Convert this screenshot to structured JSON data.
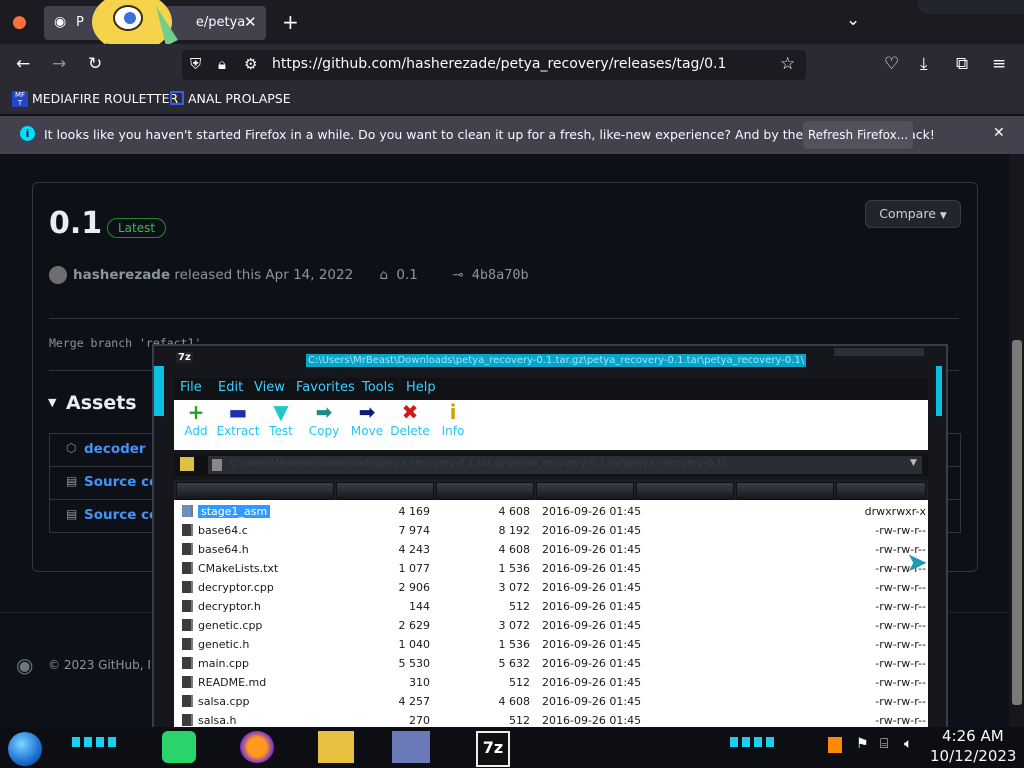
{
  "browser": {
    "tab_title": "P",
    "tab_title_tail": "e/petya",
    "url": "https://github.com/hasherezade/petya_recovery/releases/tag/0.1",
    "bookmarks": [
      "MEDIAFIRE ROULETTER",
      "ANAL PROLAPSE"
    ],
    "notice": "It looks like you haven't started Firefox in a while. Do you want to clean it up for a fresh, like-new experience? And by the way, welcome back!",
    "refresh_label": "Refresh Firefox...",
    "icons": [
      "firefox-icon",
      "github-icon",
      "close-icon",
      "new-tab-icon",
      "chevron-down-icon",
      "back-icon",
      "forward-icon",
      "reload-icon",
      "shield-icon",
      "lock-icon",
      "settings-icon",
      "star-icon",
      "pocket-icon",
      "download-icon",
      "extensions-icon",
      "menu-icon",
      "info-icon"
    ]
  },
  "release": {
    "title": "0.1",
    "badge": "Latest",
    "compare_label": "Compare",
    "author": "hasherezade",
    "released_text": "released this Apr 14, 2022",
    "tag": "0.1",
    "commit": "4b8a70b",
    "commit_message": "Merge branch 'refact1'",
    "assets_heading": "Assets",
    "assets": [
      "decoder",
      "Source code",
      "Source code"
    ],
    "footer": "© 2023 GitHub, Inc."
  },
  "sevenzip": {
    "title_path": "C:\\Users\\MrBeast\\Downloads\\petya_recovery-0.1.tar.gz\\petya_recovery-0.1.tar\\petya_recovery-0.1\\",
    "menus": [
      "File",
      "Edit",
      "View",
      "Favorites",
      "Tools",
      "Help"
    ],
    "tools": [
      {
        "label": "Add",
        "glyph": "+",
        "color": "#1fa31f"
      },
      {
        "label": "Extract",
        "glyph": "—",
        "color": "#1c2fb0"
      },
      {
        "label": "Test",
        "glyph": "▼",
        "color": "#22c7c7"
      },
      {
        "label": "Copy",
        "glyph": "➡",
        "color": "#1a8a8a"
      },
      {
        "label": "Move",
        "glyph": "➡",
        "color": "#101a7a"
      },
      {
        "label": "Delete",
        "glyph": "✖",
        "color": "#d11a1a"
      },
      {
        "label": "Info",
        "glyph": "i",
        "color": "#c8a800"
      }
    ],
    "files": [
      {
        "name": "stage1_asm",
        "size": "4 169",
        "packed": "4 608",
        "modified": "2016-09-26 01:45",
        "attr": "drwxrwxr-x"
      },
      {
        "name": "base64.c",
        "size": "7 974",
        "packed": "8 192",
        "modified": "2016-09-26 01:45",
        "attr": "-rw-rw-r--"
      },
      {
        "name": "base64.h",
        "size": "4 243",
        "packed": "4 608",
        "modified": "2016-09-26 01:45",
        "attr": "-rw-rw-r--"
      },
      {
        "name": "CMakeLists.txt",
        "size": "1 077",
        "packed": "1 536",
        "modified": "2016-09-26 01:45",
        "attr": "-rw-rw-r--"
      },
      {
        "name": "decryptor.cpp",
        "size": "2 906",
        "packed": "3 072",
        "modified": "2016-09-26 01:45",
        "attr": "-rw-rw-r--"
      },
      {
        "name": "decryptor.h",
        "size": "144",
        "packed": "512",
        "modified": "2016-09-26 01:45",
        "attr": "-rw-rw-r--"
      },
      {
        "name": "genetic.cpp",
        "size": "2 629",
        "packed": "3 072",
        "modified": "2016-09-26 01:45",
        "attr": "-rw-rw-r--"
      },
      {
        "name": "genetic.h",
        "size": "1 040",
        "packed": "1 536",
        "modified": "2016-09-26 01:45",
        "attr": "-rw-rw-r--"
      },
      {
        "name": "main.cpp",
        "size": "5 530",
        "packed": "5 632",
        "modified": "2016-09-26 01:45",
        "attr": "-rw-rw-r--"
      },
      {
        "name": "README.md",
        "size": "310",
        "packed": "512",
        "modified": "2016-09-26 01:45",
        "attr": "-rw-rw-r--"
      },
      {
        "name": "salsa.cpp",
        "size": "4 257",
        "packed": "4 608",
        "modified": "2016-09-26 01:45",
        "attr": "-rw-rw-r--"
      },
      {
        "name": "salsa.h",
        "size": "270",
        "packed": "512",
        "modified": "2016-09-26 01:45",
        "attr": "-rw-rw-r--"
      }
    ]
  },
  "taskbar": {
    "time": "4:26 AM",
    "date": "10/12/2023",
    "apps": [
      "notes-icon",
      "firefox-icon",
      "file-explorer-icon",
      "id-card-icon",
      "7zip-icon"
    ]
  }
}
